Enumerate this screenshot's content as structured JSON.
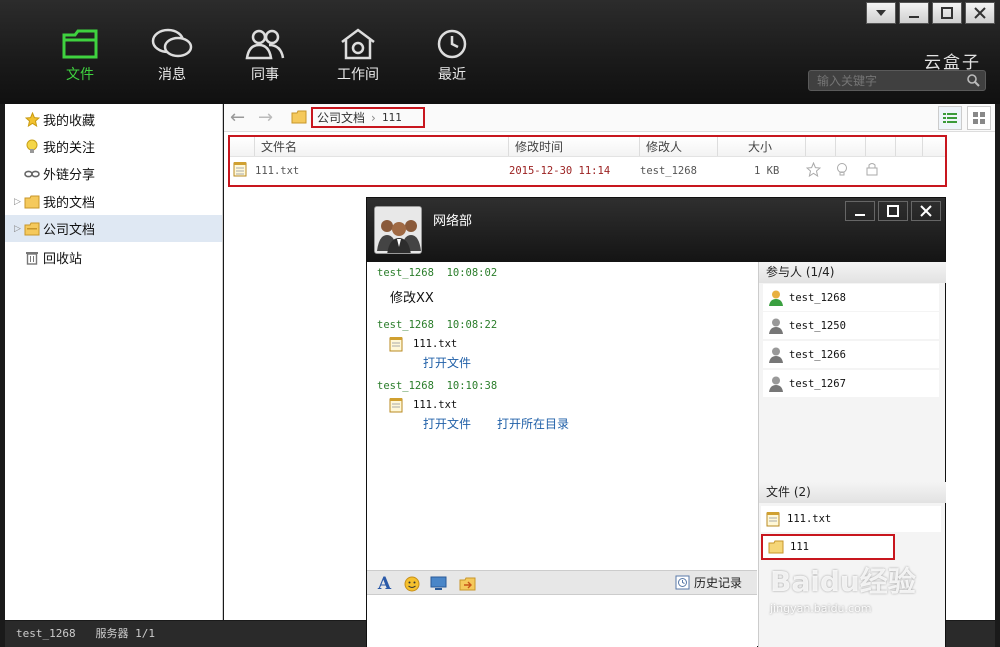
{
  "window_controls": {
    "menu_icon": "chevron-down-icon",
    "minimize_icon": "minimize-icon",
    "maximize_icon": "maximize-icon",
    "close_icon": "close-icon"
  },
  "nav": {
    "files_label": "文件",
    "messages_label": "消息",
    "colleagues_label": "同事",
    "workspace_label": "工作间",
    "recent_label": "最近",
    "active_color": "#3fd23f"
  },
  "brand": "云盒子",
  "search": {
    "placeholder": "输入关键字"
  },
  "sidebar": {
    "favorites": "我的收藏",
    "following": "我的关注",
    "shared_links": "外链分享",
    "my_docs": "我的文档",
    "company_docs": "公司文档",
    "recycle_bin": "回收站"
  },
  "breadcrumb": {
    "root": "公司文档",
    "separator": "›",
    "current": "111"
  },
  "file_table": {
    "columns": {
      "name": "文件名",
      "modified": "修改时间",
      "modifier": "修改人",
      "size": "大小"
    },
    "rows": [
      {
        "name": "111.txt",
        "modified": "2015-12-30 11:14",
        "modifier": "test_1268",
        "size": "1 KB"
      }
    ]
  },
  "status": {
    "user": "test_1268",
    "server_label": "服务器",
    "server_count": "1/1"
  },
  "chat": {
    "title": "网络部",
    "messages": [
      {
        "sender": "test_1268",
        "time": "10:08:02",
        "text": "修改XX"
      },
      {
        "sender": "test_1268",
        "time": "10:08:22",
        "file": "111.txt",
        "link1": "打开文件"
      },
      {
        "sender": "test_1268",
        "time": "10:10:38",
        "file": "111.txt",
        "link1": "打开文件",
        "link2": "打开所在目录"
      }
    ],
    "history_label": "历史记录",
    "participants_header": "参与人 (1/4)",
    "participants": [
      "test_1268",
      "test_1250",
      "test_1266",
      "test_1267"
    ],
    "files_header": "文件 (2)",
    "files": [
      "111.txt",
      "111"
    ]
  },
  "watermark": {
    "main": "Baidu经验",
    "sub": "jingyan.baidu.com"
  },
  "colors": {
    "highlight_red": "#c8161e",
    "link_blue": "#2060a8",
    "meta_green": "#2a7d2a"
  }
}
